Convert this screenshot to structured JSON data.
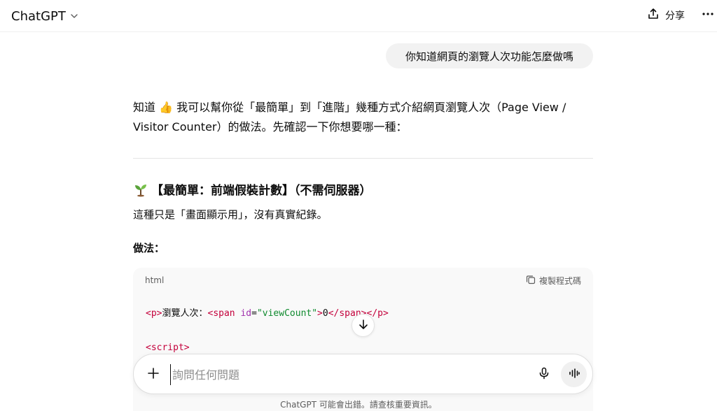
{
  "header": {
    "model_title": "ChatGPT",
    "share_label": "分享"
  },
  "conversation": {
    "user_message": "你知道網頁的瀏覽人次功能怎麼做嗎",
    "assistant": {
      "intro": "知道 👍 我可以幫你從「最簡單」到「進階」幾種方式介紹網頁瀏覽人次（Page View / Visitor Counter）的做法。先確認一下你想要哪一種：",
      "section_title": "【最簡單：前端假裝計數】（不需伺服器）",
      "section_desc": "這種只是「畫面顯示用」，沒有真實紀錄。",
      "method_label": "做法：",
      "code_block": {
        "language": "html",
        "copy_label": "複製程式碼",
        "line1": {
          "p_open": "<p>",
          "text": "瀏覽人次：",
          "span_open": "<span ",
          "attr_name": "id",
          "eq": "=",
          "attr_value": "\"viewCount\"",
          "gt": ">",
          "count": "0",
          "span_close": "</span>",
          "p_close": "</p>"
        },
        "line2": "<script>"
      }
    }
  },
  "composer": {
    "placeholder": "詢問任何問題"
  },
  "footer": {
    "disclaimer": "ChatGPT 可能會出錯。請查核重要資訊。"
  },
  "colors": {
    "user_bubble": "#f2f2f2",
    "code_bg": "#f9f9f9",
    "code_tag": "#c4003b",
    "code_attr": "#a031ad",
    "code_string": "#0f8a2e"
  }
}
